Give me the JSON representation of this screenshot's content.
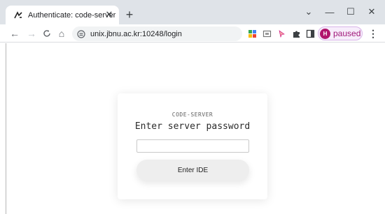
{
  "browser": {
    "tab": {
      "title": "Authenticate: code-server",
      "favicon": "code-server-logo-icon",
      "close": "✕"
    },
    "new_tab": "+",
    "window": {
      "collapse": "⌄",
      "minimize": "—",
      "maximize": "☐",
      "close": "✕"
    },
    "toolbar": {
      "back": "←",
      "forward": "→",
      "reload": "C",
      "home": "⌂",
      "url": "unix.jbnu.ac.kr:10248/login",
      "site_info_icon": "tune-icon",
      "extensions": [
        "google-drive-icon",
        "screen-capture-icon",
        "cursor-extension-icon",
        "puzzle-icon",
        "side-panel-icon"
      ],
      "profile": {
        "initial": "H",
        "status": "paused"
      },
      "menu": "⋮"
    }
  },
  "page": {
    "eyebrow": "CODE-SERVER",
    "heading": "Enter server password",
    "password": {
      "value": "",
      "placeholder": ""
    },
    "submit_label": "Enter IDE"
  },
  "colors": {
    "tabstrip": "#dfe3e8",
    "profile_accent": "#b1166d",
    "button": "#eeeeee"
  }
}
